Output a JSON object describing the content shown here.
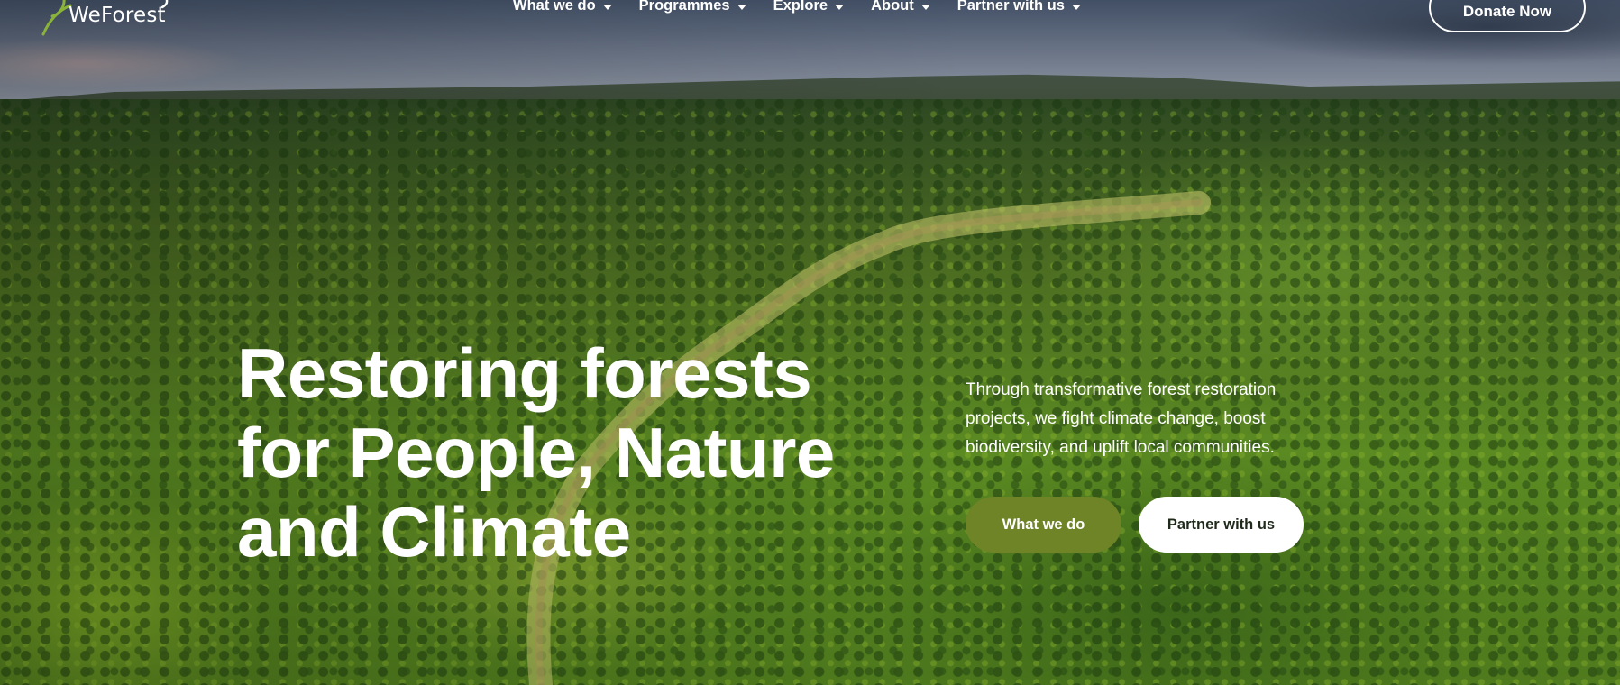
{
  "brand": {
    "logo_text": "WeForest",
    "accent_color": "#6f8427"
  },
  "nav": {
    "items": [
      {
        "label": "What we do",
        "icon": "chevron-down-icon"
      },
      {
        "label": "Programmes",
        "icon": "chevron-down-icon"
      },
      {
        "label": "Explore",
        "icon": "chevron-down-icon"
      },
      {
        "label": "About",
        "icon": "chevron-down-icon"
      },
      {
        "label": "Partner with us",
        "icon": "chevron-down-icon"
      }
    ],
    "donate_label": "Donate Now"
  },
  "hero": {
    "headline_lines": [
      "Restoring forests",
      "for People, Nature",
      "and Climate"
    ],
    "intro": "Through transformative forest restoration projects, we fight climate change, boost biodiversity, and uplift local communities.",
    "cta_primary": "What we do",
    "cta_secondary": "Partner with us"
  }
}
